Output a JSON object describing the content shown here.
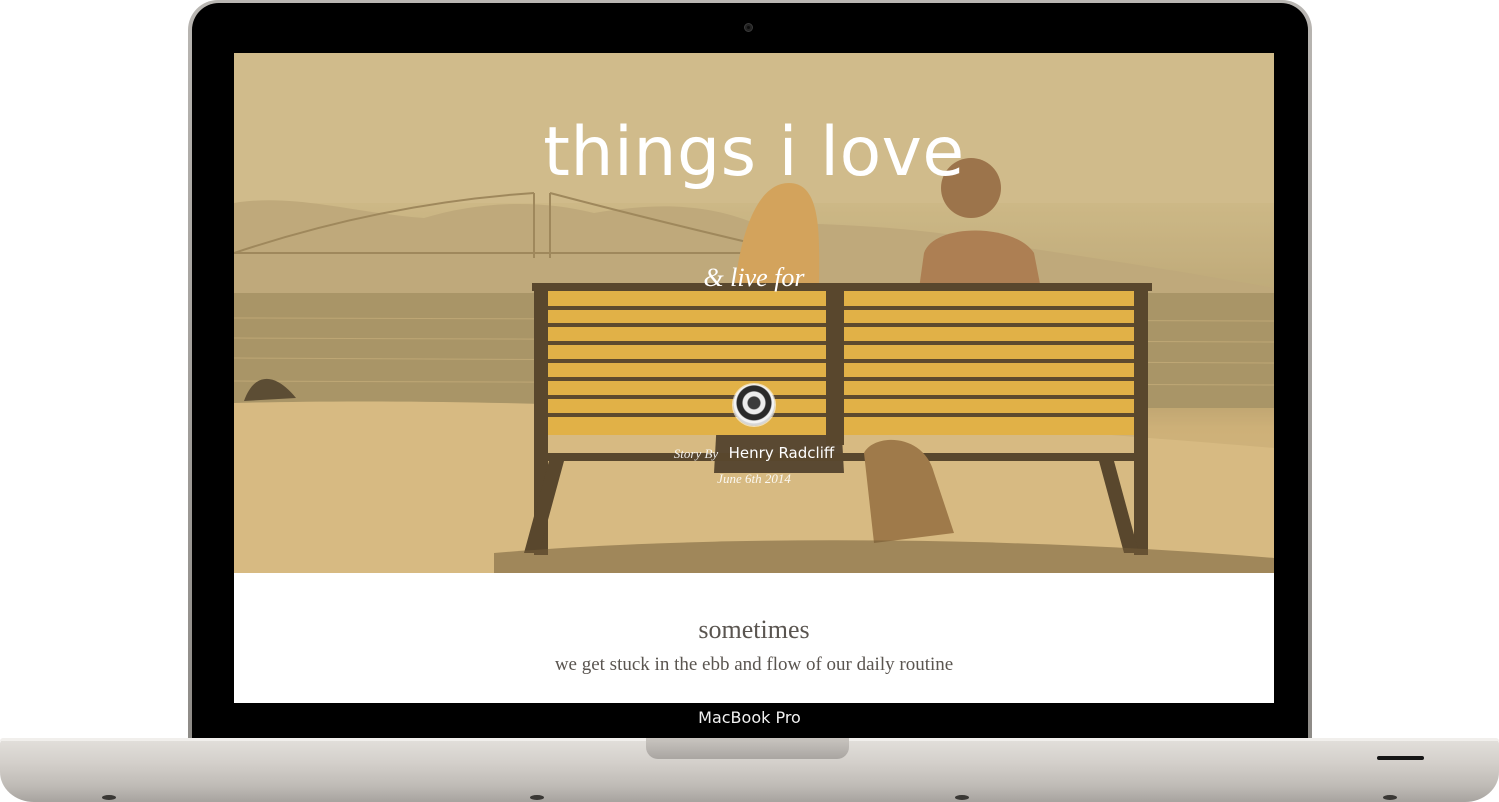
{
  "device": {
    "label": "MacBook Pro"
  },
  "hero": {
    "title": "things i love",
    "subtitle": "& live for",
    "byline_prefix": "Story By",
    "author": "Henry Radcliff",
    "date": "June 6th 2014",
    "image_description_icon": "photo-couple-bench-icon"
  },
  "content": {
    "heading": "sometimes",
    "text": "we get stuck in the ebb and flow of our daily routine"
  },
  "colors": {
    "hero_tint": "#c9b889",
    "bench_wood": "#d9a530",
    "body_text": "#5a5550",
    "frame": "#000000"
  }
}
